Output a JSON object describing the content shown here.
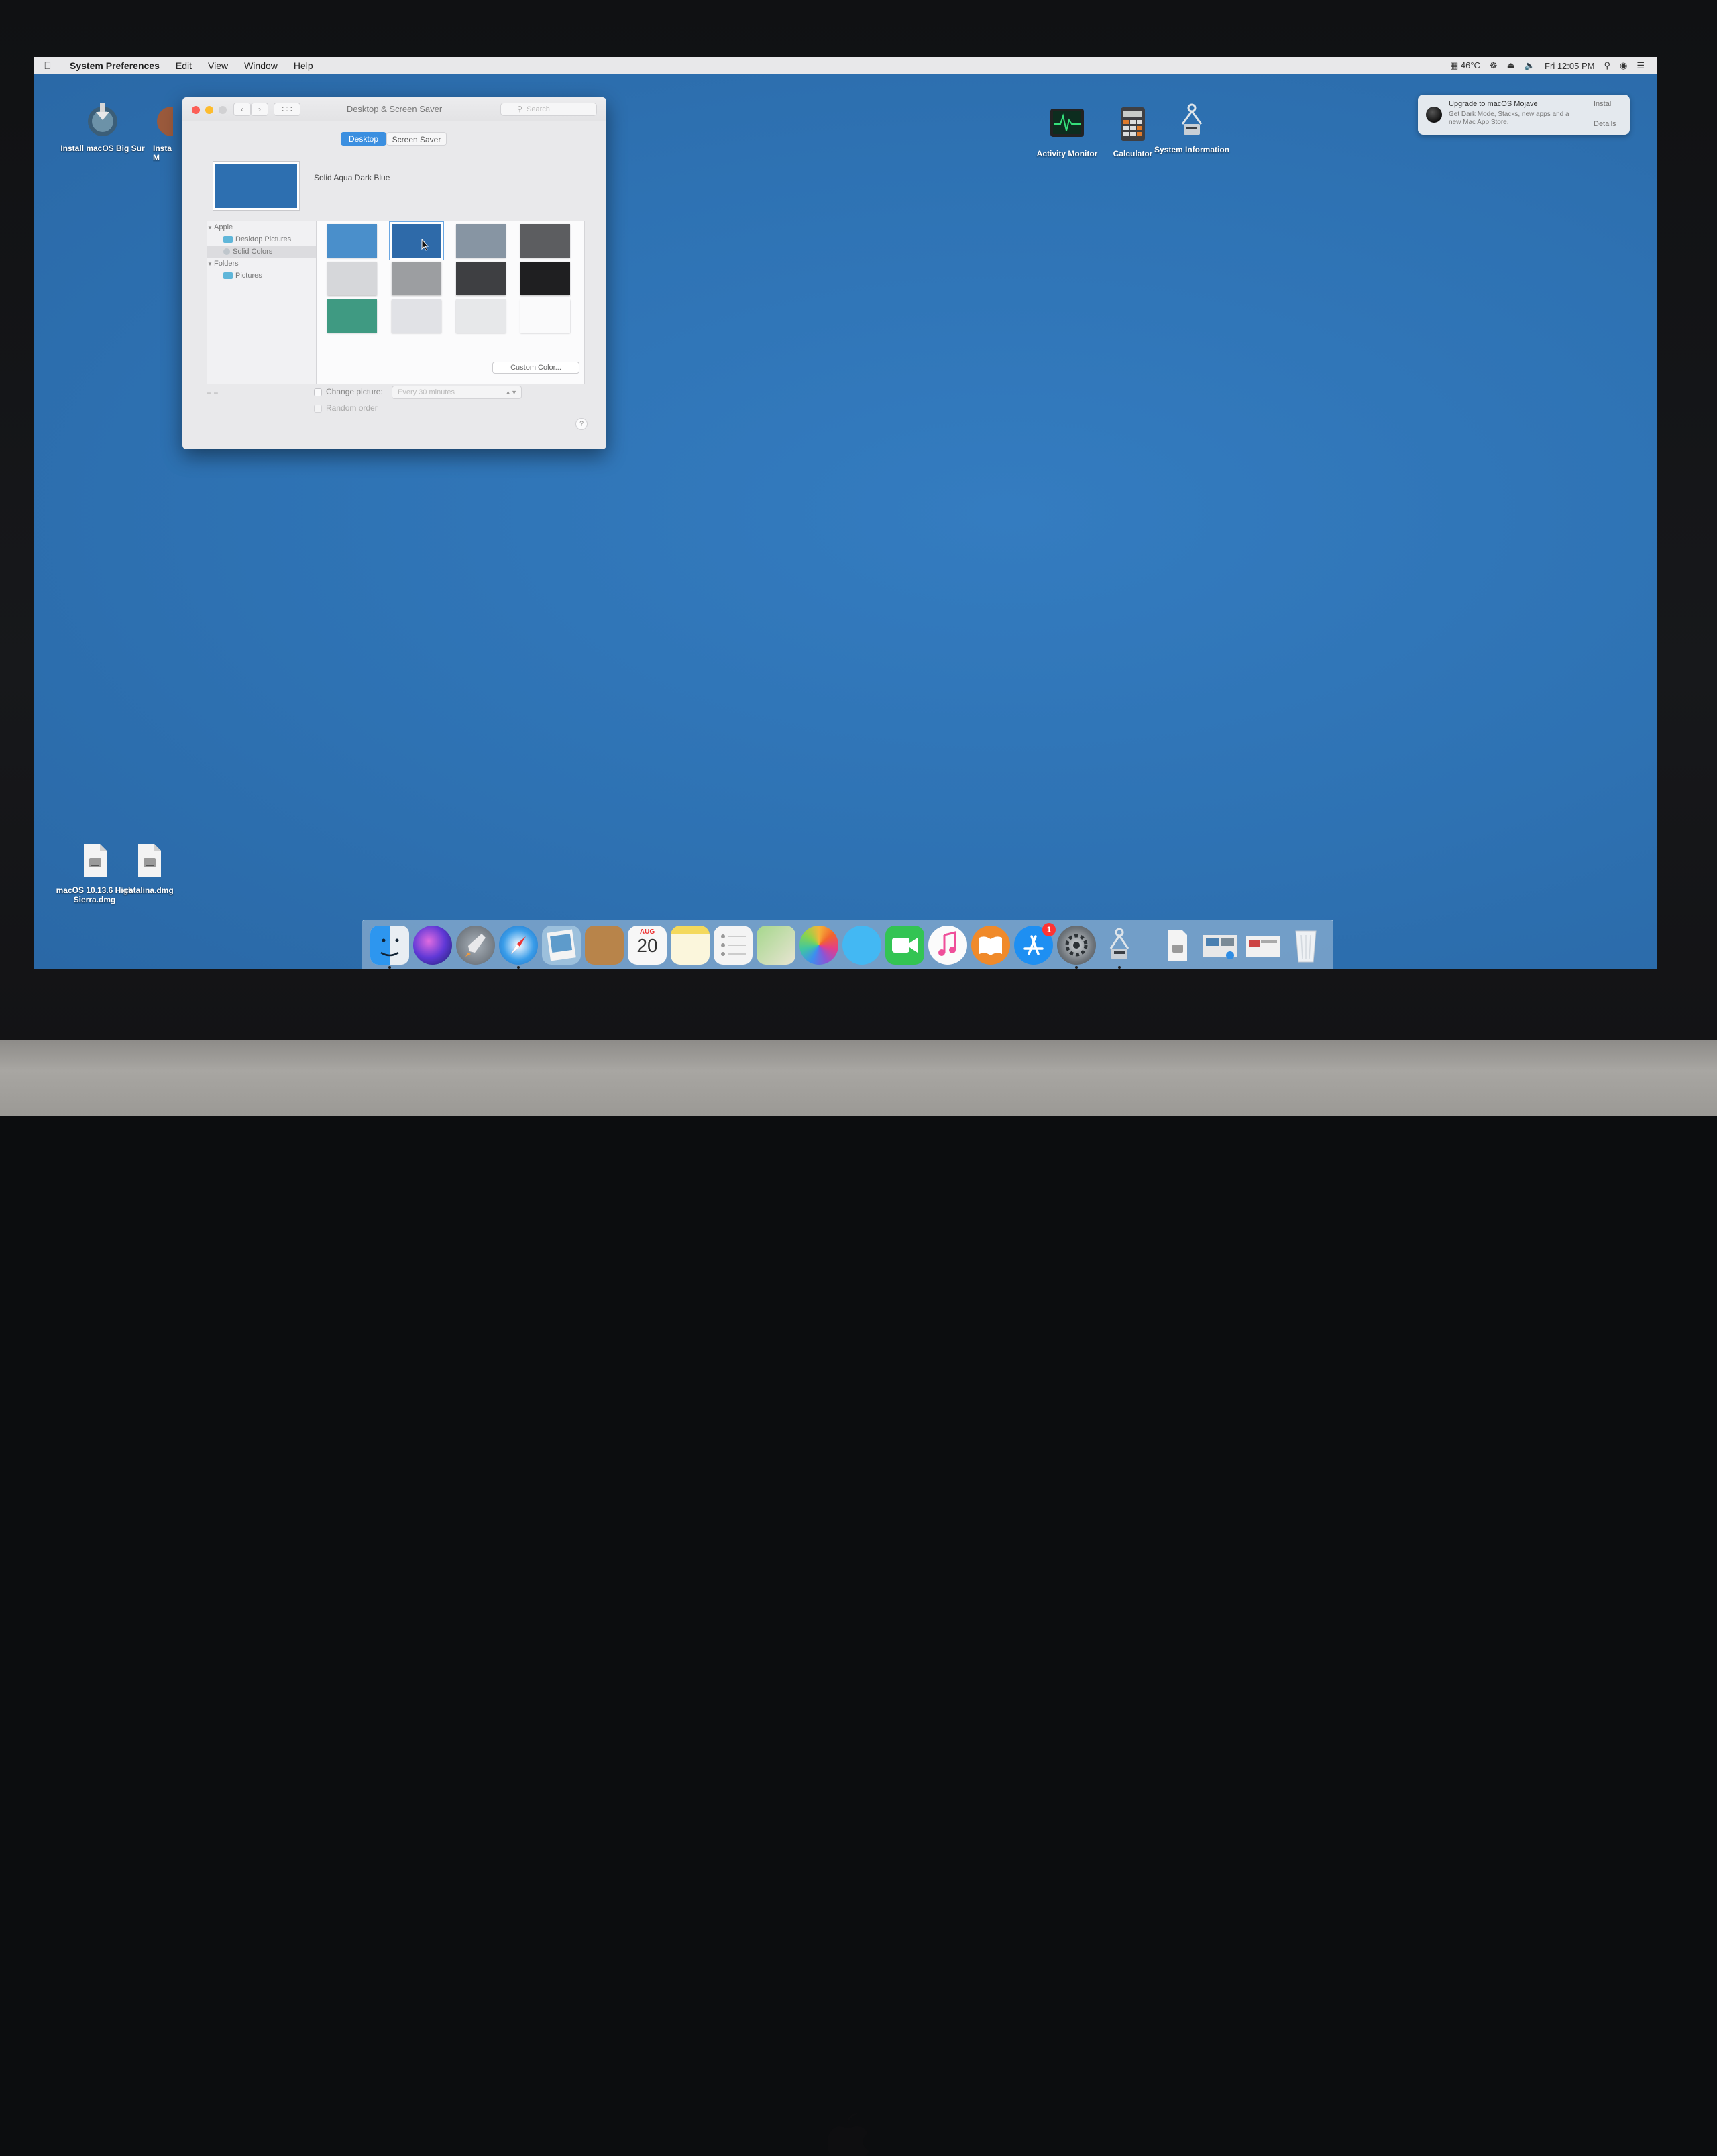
{
  "menubar": {
    "app": "System Preferences",
    "menus": [
      "Edit",
      "View",
      "Window",
      "Help"
    ],
    "status": {
      "temperature": "46°C",
      "clock": "Fri 12:05 PM"
    }
  },
  "desktop": {
    "icons_top_left": [
      {
        "label": "Install macOS Big Sur",
        "icon": "installer-icon"
      },
      {
        "label": "Insta M",
        "icon": "installer-icon"
      }
    ],
    "icons_top_right": [
      {
        "label": "Activity Monitor",
        "icon": "activity-monitor-icon"
      },
      {
        "label": "Calculator",
        "icon": "calculator-icon"
      },
      {
        "label": "System Information",
        "icon": "system-information-icon"
      }
    ],
    "icons_bottom_left": [
      {
        "label": "macOS 10.13.6 High Sierra.dmg",
        "icon": "disk-image-icon"
      },
      {
        "label": "catalina.dmg",
        "icon": "disk-image-icon"
      }
    ]
  },
  "notification": {
    "title": "Upgrade to macOS Mojave",
    "body": "Get Dark Mode, Stacks, new apps and a new Mac App Store.",
    "install_label": "Install",
    "details_label": "Details"
  },
  "window": {
    "title": "Desktop & Screen Saver",
    "search_placeholder": "Search",
    "tabs": [
      {
        "label": "Desktop",
        "selected": true
      },
      {
        "label": "Screen Saver",
        "selected": false
      }
    ],
    "current_picture": "Solid Aqua Dark Blue",
    "sidebar": {
      "groups": [
        {
          "label": "Apple",
          "items": [
            "Desktop Pictures",
            "Solid Colors"
          ]
        },
        {
          "label": "Folders",
          "items": [
            "Pictures"
          ]
        }
      ],
      "selected_item": "Solid Colors"
    },
    "swatches": [
      {
        "color": "#4a8fcb",
        "selected": false
      },
      {
        "color": "#2e6aa9",
        "selected": true
      },
      {
        "color": "#8795a3",
        "selected": false
      },
      {
        "color": "#5c5d60",
        "selected": false
      },
      {
        "color": "#d6d7da",
        "selected": false
      },
      {
        "color": "#9c9ea1",
        "selected": false
      },
      {
        "color": "#3e3f42",
        "selected": false
      },
      {
        "color": "#1f1f21",
        "selected": false
      },
      {
        "color": "#3f9a82",
        "selected": false
      },
      {
        "color": "#e1e2e6",
        "selected": false
      },
      {
        "color": "#e7e8ea",
        "selected": false
      },
      {
        "color": "#fafafb",
        "selected": false
      }
    ],
    "custom_color_label": "Custom Color...",
    "add_remove_label": "+ −",
    "change_picture_label": "Change picture:",
    "interval_value": "Every 30 minutes",
    "random_order_label": "Random order",
    "help_label": "?"
  },
  "dock": {
    "apps": [
      {
        "name": "finder-icon",
        "color": "#3da0f2",
        "running": true
      },
      {
        "name": "siri-icon",
        "color": "#6b3fd3",
        "running": false
      },
      {
        "name": "launchpad-icon",
        "color": "#8d949c",
        "running": false
      },
      {
        "name": "safari-icon",
        "color": "#2f8de4",
        "running": true
      },
      {
        "name": "preview-icon",
        "color": "#8fb6d6",
        "running": false
      },
      {
        "name": "notebook-icon",
        "color": "#b98545",
        "running": false
      },
      {
        "name": "calendar-icon",
        "color": "#f7f7f7",
        "running": false
      },
      {
        "name": "notes-icon",
        "color": "#f6e58a",
        "running": false
      },
      {
        "name": "reminders-icon",
        "color": "#f4f4f4",
        "running": false
      },
      {
        "name": "maps-icon",
        "color": "#8cc67a",
        "running": false
      },
      {
        "name": "photos-icon",
        "color": "#f2f2f2",
        "running": false
      },
      {
        "name": "messages-icon",
        "color": "#43b8f3",
        "running": false
      },
      {
        "name": "facetime-icon",
        "color": "#2fc14e",
        "running": false
      },
      {
        "name": "itunes-icon",
        "color": "#f15aa0",
        "running": false
      },
      {
        "name": "ibooks-icon",
        "color": "#f08a2a",
        "running": false
      },
      {
        "name": "app-store-icon",
        "color": "#1e8ff2",
        "running": false
      },
      {
        "name": "system-preferences-icon",
        "color": "#7f858b",
        "running": true
      },
      {
        "name": "system-information-icon",
        "color": "#c7ccd2",
        "running": true
      }
    ],
    "calendar": {
      "month": "AUG",
      "day": "20"
    },
    "app_store_badge": "1",
    "others": [
      {
        "name": "document-icon"
      },
      {
        "name": "screenshots-stack-icon"
      },
      {
        "name": "folder-stack-icon"
      },
      {
        "name": "trash-icon"
      }
    ]
  }
}
